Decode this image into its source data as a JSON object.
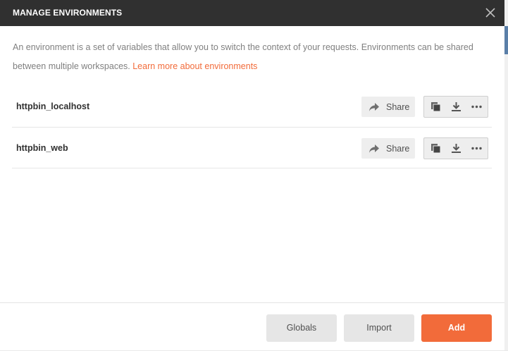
{
  "modal": {
    "title": "MANAGE ENVIRONMENTS",
    "description": "An environment is a set of variables that allow you to switch the context of your requests. Environments can be shared between multiple workspaces.",
    "learn_more_link": "Learn more about environments"
  },
  "environments": [
    {
      "name": "httpbin_localhost",
      "share_label": "Share"
    },
    {
      "name": "httpbin_web",
      "share_label": "Share"
    }
  ],
  "footer": {
    "globals_label": "Globals",
    "import_label": "Import",
    "add_label": "Add"
  },
  "colors": {
    "header_bg": "#303030",
    "accent": "#f26b3a",
    "button_grey": "#e6e6e6"
  },
  "icons": [
    "close-icon",
    "share-arrow-icon",
    "duplicate-icon",
    "download-icon",
    "more-options-icon"
  ]
}
